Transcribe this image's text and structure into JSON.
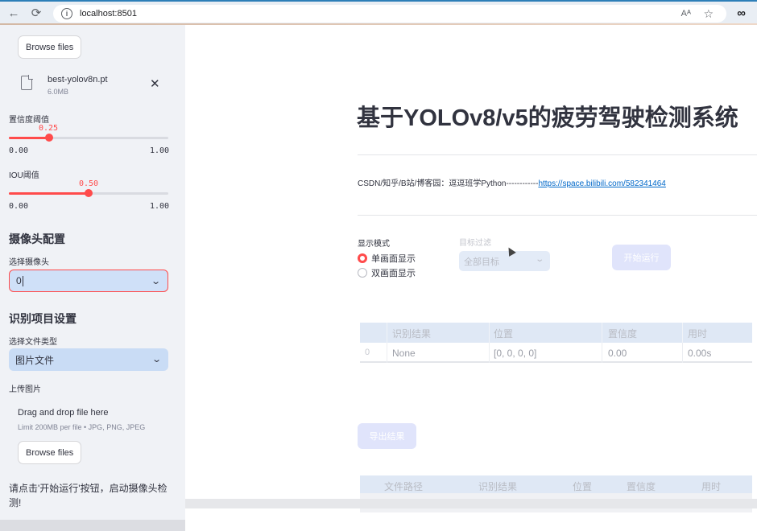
{
  "browser": {
    "url": "localhost:8501",
    "read_aloud": "Aᴬ"
  },
  "sidebar": {
    "model_file": {
      "browse_label": "Browse files",
      "name": "best-yolov8n.pt",
      "size": "6.0MB"
    },
    "confidence": {
      "label": "置信度阈值",
      "value": "0.25",
      "min": "0.00",
      "max": "1.00",
      "fraction": 0.25
    },
    "iou": {
      "label": "IOU阈值",
      "value": "0.50",
      "min": "0.00",
      "max": "1.00",
      "fraction": 0.5
    },
    "camera": {
      "heading": "摄像头配置",
      "label": "选择摄像头",
      "value": "0"
    },
    "recognition": {
      "heading": "识别项目设置",
      "file_type_label": "选择文件类型",
      "file_type_value": "图片文件"
    },
    "upload": {
      "label": "上传图片",
      "drop_text": "Drag and drop file here",
      "limit_text": "Limit 200MB per file • JPG, PNG, JPEG",
      "browse_label": "Browse files"
    },
    "status": "请点击'开始运行'按钮，启动摄像头检测!"
  },
  "main": {
    "title": "基于YOLOv8/v5的疲劳驾驶检测系统",
    "credit_text": "CSDN/知乎/B站/博客园：逗逗班学Python------------",
    "credit_link": "https://space.bilibili.com/582341464",
    "display_mode": {
      "label": "显示模式",
      "options": [
        "单画面显示",
        "双画面显示"
      ],
      "selected": 0
    },
    "target_filter": {
      "label": "目标过滤",
      "value": "全部目标"
    },
    "run_button": "开始运行",
    "results_table": {
      "columns": [
        "识别结果",
        "位置",
        "置信度",
        "用时"
      ],
      "rows": [
        {
          "index": "0",
          "result": "None",
          "position": "[0, 0, 0, 0]",
          "confidence": "0.00",
          "time": "0.00s"
        }
      ]
    },
    "export_button": "导出结果",
    "history_table": {
      "columns": [
        "文件路径",
        "识别结果",
        "位置",
        "置信度",
        "用时"
      ],
      "empty_text": "empty"
    }
  },
  "colors": {
    "accent": "#ff4b4b",
    "link": "#0068c9",
    "sidebar_bg": "#f0f2f6",
    "select_bg": "#c9dcf5"
  }
}
